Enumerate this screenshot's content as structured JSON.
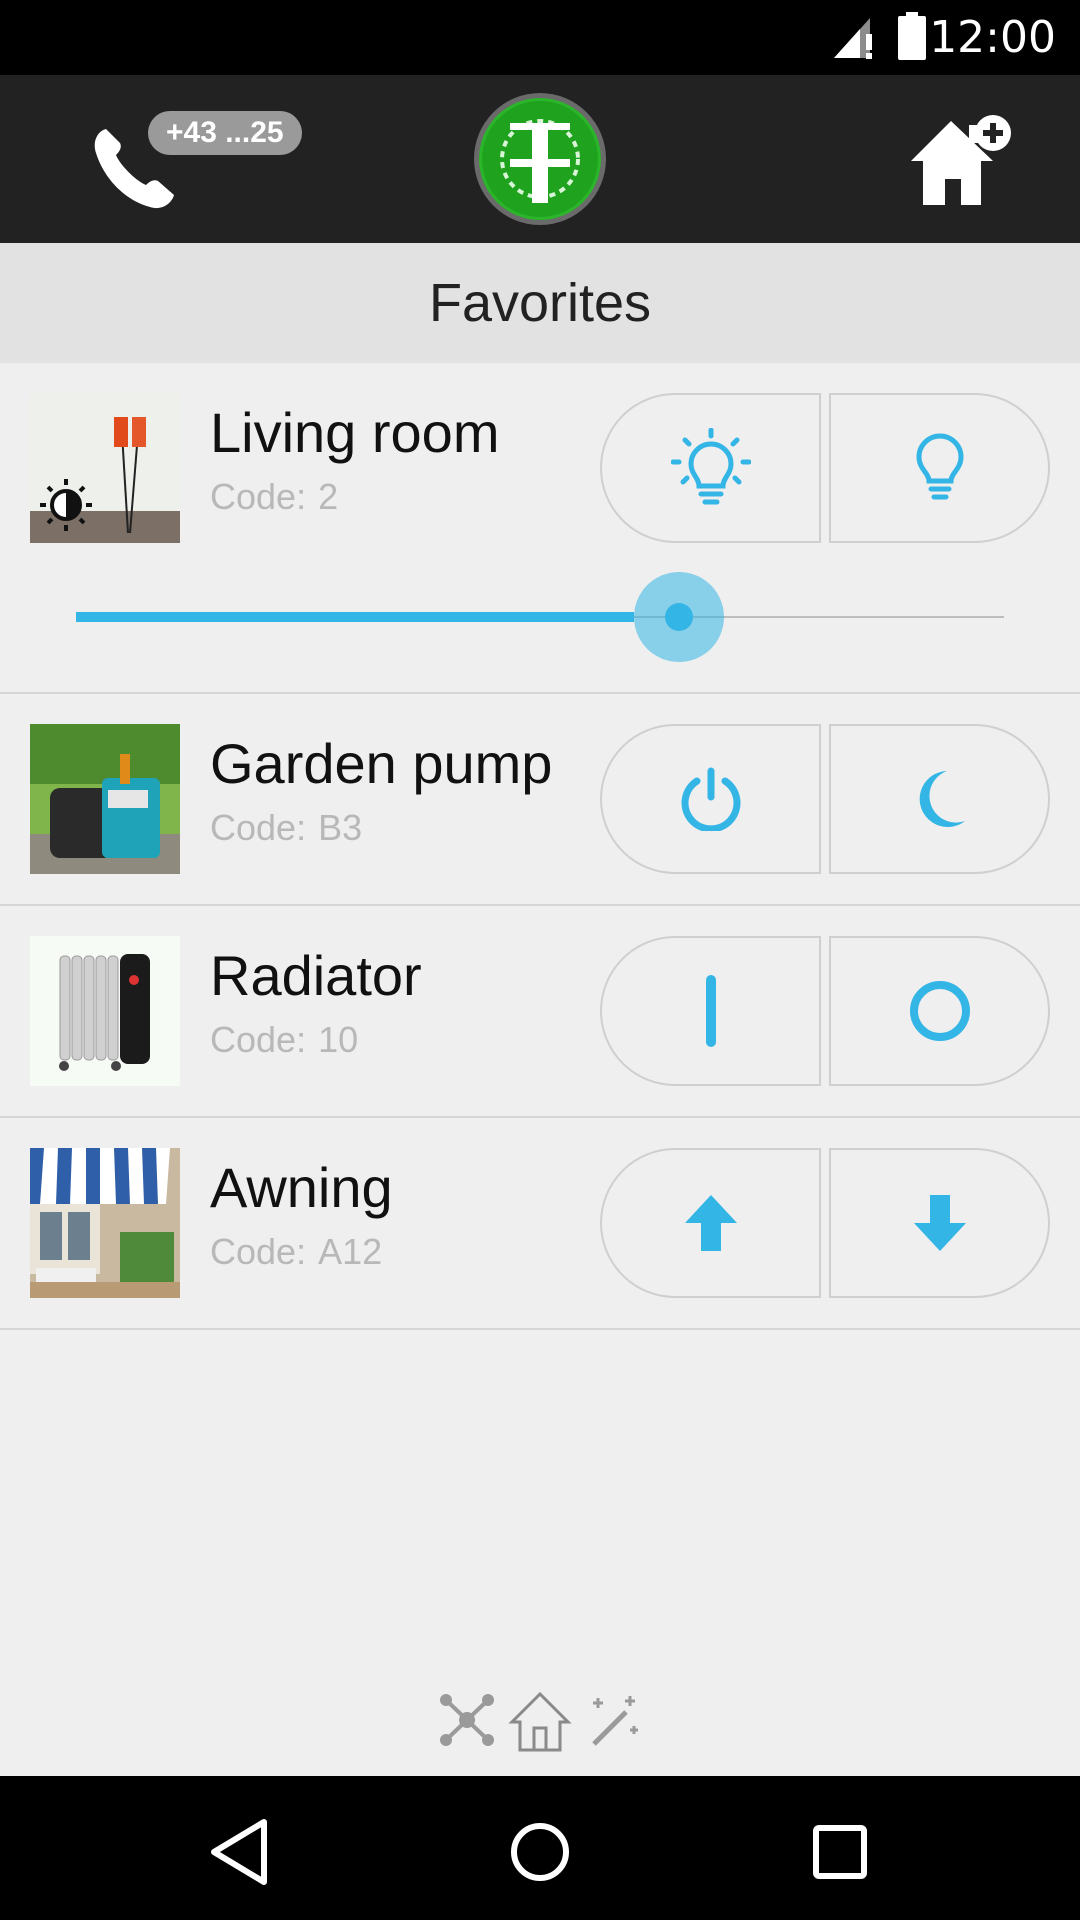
{
  "status_bar": {
    "time": "12:00",
    "icons": [
      "signal-alert-icon",
      "battery-icon"
    ]
  },
  "app_bar": {
    "phone_badge": "+43 ...25",
    "icons": [
      "phone-icon",
      "it-gear-logo",
      "home-add-icon"
    ],
    "logo_letters": "IT"
  },
  "section": {
    "title": "Favorites"
  },
  "code_label": "Code:",
  "devices": [
    {
      "name": "Living room",
      "code": "2",
      "left_icon": "bulb-on-icon",
      "right_icon": "bulb-off-icon",
      "slider_level": 0.65
    },
    {
      "name": "Garden pump",
      "code": "B3",
      "left_icon": "power-icon",
      "right_icon": "moon-icon"
    },
    {
      "name": "Radiator",
      "code": "10",
      "left_icon": "on-bar-icon",
      "right_icon": "off-circle-icon"
    },
    {
      "name": "Awning",
      "code": "A12",
      "left_icon": "arrow-up-icon",
      "right_icon": "arrow-down-icon"
    }
  ],
  "bottom_modes": [
    "network-icon",
    "home-icon",
    "magic-wand-icon"
  ],
  "nav_bar": [
    "back-icon",
    "home-circle-icon",
    "recents-icon"
  ],
  "colors": {
    "accent": "#33b5e5",
    "app_bar": "#222222",
    "background": "#efefef",
    "logo_green": "#2bb52b"
  }
}
